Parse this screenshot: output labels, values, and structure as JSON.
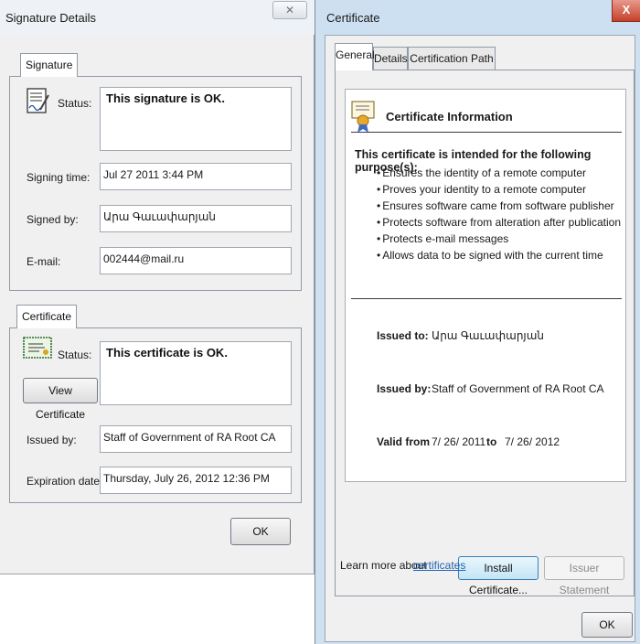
{
  "signature_details": {
    "title": "Signature Details",
    "close_glyph": "✕",
    "signature_group": {
      "tab_label": "Signature",
      "status_label": "Status:",
      "status_text": "This signature is OK.",
      "signing_time_label": "Signing time:",
      "signing_time_value": "Jul 27 2011 3:44 PM",
      "signed_by_label": "Signed by:",
      "signed_by_value": "Արա Գաւափարյան",
      "email_label": "E-mail:",
      "email_value": "002444@mail.ru"
    },
    "certificate_group": {
      "tab_label": "Certificate",
      "status_label": "Status:",
      "status_text": "This certificate is OK.",
      "view_certificate_button": "View Certificate",
      "issued_by_label": "Issued by:",
      "issued_by_value": "Staff of Government of RA Root CA",
      "expiration_label": "Expiration date:",
      "expiration_value": "Thursday, July 26, 2012 12:36 PM"
    },
    "ok_button": "OK"
  },
  "certificate": {
    "title": "Certificate",
    "close_glyph": "X",
    "tabs": [
      {
        "label": "General",
        "active": true
      },
      {
        "label": "Details",
        "active": false
      },
      {
        "label": "Certification Path",
        "active": false
      }
    ],
    "info_heading": "Certificate Information",
    "purpose_heading": "This certificate is intended for the following purpose(s):",
    "purposes": [
      "Ensures the identity of a remote computer",
      "Proves your identity to a remote computer",
      "Ensures software came from software publisher",
      "Protects software from alteration after publication",
      "Protects e-mail messages",
      "Allows data to be signed with the current time"
    ],
    "issued_to_label": "Issued to:",
    "issued_to_value": "Արա Գաւափարյան",
    "issued_by_label": "Issued by:",
    "issued_by_value": "Staff of Government of RA Root CA",
    "valid_from_label": "Valid from",
    "valid_from_value": "7/ 26/ 2011",
    "to_label": "to",
    "valid_to_value": "7/ 26/ 2012",
    "install_button": "Install Certificate...",
    "issuer_statement_button": "Issuer Statement",
    "learn_more_text": "Learn more about",
    "learn_more_link": "certificates",
    "ok_button": "OK"
  }
}
